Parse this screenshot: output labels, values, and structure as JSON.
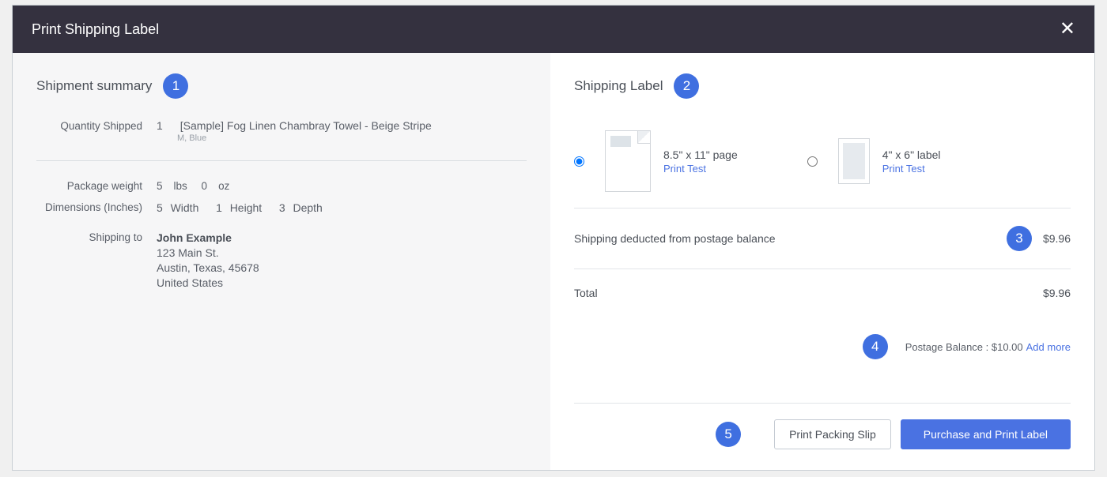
{
  "modal": {
    "title": "Print Shipping Label"
  },
  "annotations": {
    "a1": "1",
    "a2": "2",
    "a3": "3",
    "a4": "4",
    "a5": "5"
  },
  "summary": {
    "heading": "Shipment summary",
    "labels": {
      "qty": "Quantity Shipped",
      "weight": "Package weight",
      "dims": "Dimensions (Inches)",
      "shipto": "Shipping to"
    },
    "item": {
      "qty": "1",
      "name": "[Sample] Fog Linen Chambray Towel - Beige Stripe",
      "variant": "M, Blue"
    },
    "weight": {
      "lbs_v": "5",
      "lbs_u": "lbs",
      "oz_v": "0",
      "oz_u": "oz"
    },
    "dimensions": {
      "w_v": "5",
      "w_l": "Width",
      "h_v": "1",
      "h_l": "Height",
      "d_v": "3",
      "d_l": "Depth"
    },
    "address": {
      "name": "John Example",
      "line1": "123 Main St.",
      "line2": "Austin, Texas, 45678",
      "line3": "United States"
    }
  },
  "label": {
    "heading": "Shipping Label",
    "options": {
      "letter": {
        "title": "8.5\" x 11\" page",
        "link": "Print Test"
      },
      "thermal": {
        "title": "4\" x 6\" label",
        "link": "Print Test"
      }
    },
    "deducted": {
      "label": "Shipping deducted from postage balance",
      "amount": "$9.96"
    },
    "total": {
      "label": "Total",
      "amount": "$9.96"
    },
    "postage": {
      "text": "Postage Balance : $10.00",
      "link": "Add more"
    }
  },
  "footer": {
    "secondary": "Print Packing Slip",
    "primary": "Purchase and Print Label"
  }
}
